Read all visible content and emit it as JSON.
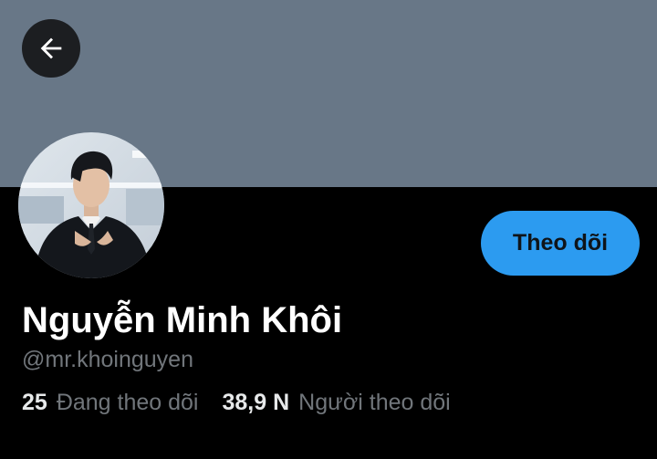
{
  "profile": {
    "display_name": "Nguyễn Minh Khôi",
    "handle": "@mr.khoinguyen",
    "avatar_icon": "avatar-photo",
    "banner_color": "#687787"
  },
  "header": {
    "back_icon": "arrow-left-icon"
  },
  "actions": {
    "follow_label": "Theo dõi",
    "follow_color": "#2c9bf0"
  },
  "stats": {
    "following_count": "25",
    "following_label": "Đang theo dõi",
    "followers_count": "38,9 N",
    "followers_label": "Người theo dõi"
  }
}
